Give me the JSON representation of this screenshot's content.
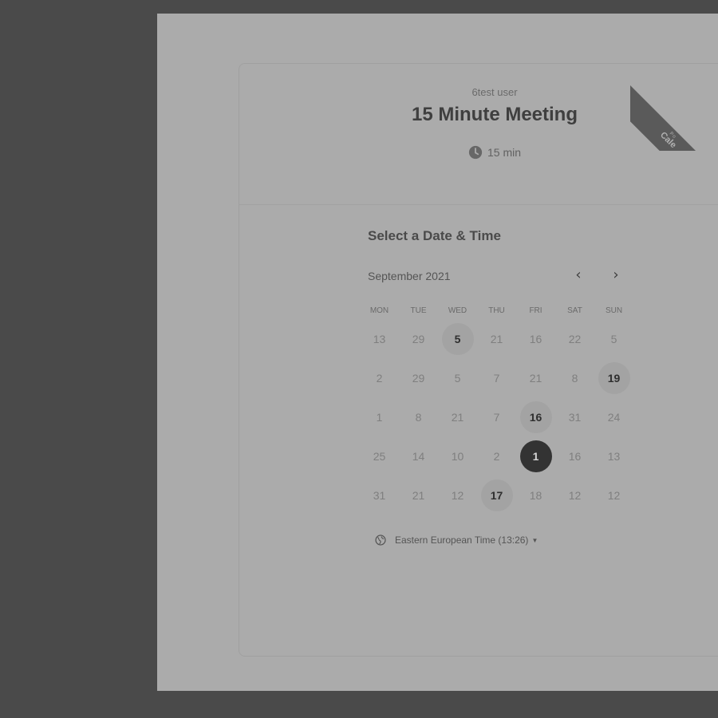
{
  "event": {
    "owner": "6test user",
    "title": "15 Minute Meeting",
    "duration": "15 min"
  },
  "ribbon": {
    "line1": "Po",
    "line2": "Cale"
  },
  "calendar": {
    "heading": "Select a Date & Time",
    "month_label": "September 2021",
    "weekdays": [
      "MON",
      "TUE",
      "WED",
      "THU",
      "FRI",
      "SAT",
      "SUN"
    ],
    "weeks": [
      [
        {
          "d": "13"
        },
        {
          "d": "29"
        },
        {
          "d": "5",
          "s": "available"
        },
        {
          "d": "21"
        },
        {
          "d": "16"
        },
        {
          "d": "22"
        },
        {
          "d": "5"
        }
      ],
      [
        {
          "d": "2"
        },
        {
          "d": "29"
        },
        {
          "d": "5"
        },
        {
          "d": "7"
        },
        {
          "d": "21"
        },
        {
          "d": "8"
        },
        {
          "d": "19",
          "s": "available"
        }
      ],
      [
        {
          "d": "1"
        },
        {
          "d": "8"
        },
        {
          "d": "21"
        },
        {
          "d": "7"
        },
        {
          "d": "16",
          "s": "available"
        },
        {
          "d": "31"
        },
        {
          "d": "24"
        }
      ],
      [
        {
          "d": "25"
        },
        {
          "d": "14"
        },
        {
          "d": "10"
        },
        {
          "d": "2"
        },
        {
          "d": "1",
          "s": "selected"
        },
        {
          "d": "16"
        },
        {
          "d": "13"
        }
      ],
      [
        {
          "d": "31"
        },
        {
          "d": "21"
        },
        {
          "d": "12"
        },
        {
          "d": "17",
          "s": "available"
        },
        {
          "d": "18"
        },
        {
          "d": "12"
        },
        {
          "d": "12"
        }
      ]
    ],
    "prev_icon": "chevron-left-icon",
    "next_icon": "chevron-right-icon"
  },
  "timezone": {
    "label": "Eastern European Time (13:26)",
    "icon": "globe-icon"
  }
}
